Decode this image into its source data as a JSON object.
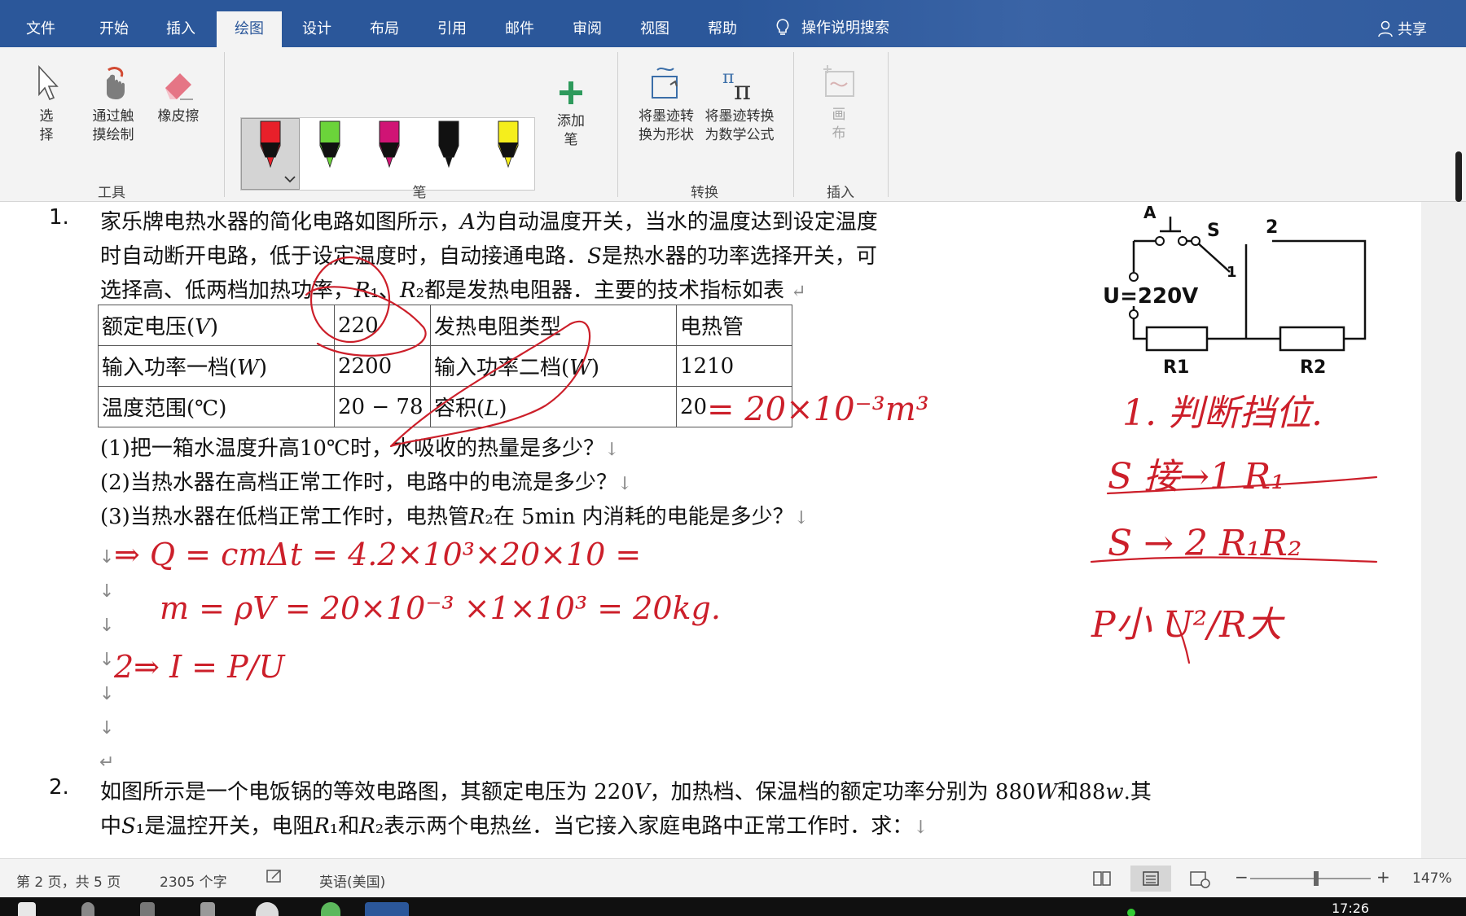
{
  "ribbon_tabs": [
    "文件",
    "开始",
    "插入",
    "绘图",
    "设计",
    "布局",
    "引用",
    "邮件",
    "审阅",
    "视图",
    "帮助"
  ],
  "active_tab": "绘图",
  "tell_me": "操作说明搜索",
  "share": "共享",
  "tools_group": {
    "label": "工具",
    "select": "选\n择",
    "touch_draw": "通过触\n摸绘制",
    "eraser": "橡皮擦"
  },
  "pens_group": {
    "label": "笔",
    "pen_colors": [
      "#e8202a",
      "#6bd43a",
      "#d01475",
      "#111111",
      "#f5ee1c"
    ],
    "add_pen": "添加\n笔"
  },
  "convert_group": {
    "label": "转换",
    "ink_to_shape": "将墨迹转\n换为形状",
    "ink_to_math": "将墨迹转换\n为数学公式"
  },
  "insert_group": {
    "label": "插入",
    "canvas": "画\n布"
  },
  "document": {
    "q1_number": "1.",
    "q1_line1": "家乐牌电热水器的简化电路如图所示，𝐴为自动温度开关，当水的温度达到设定温度",
    "q1_line2": "时自动断开电路，低于设定温度时，自动接通电路．𝑆是热水器的功率选择开关，可",
    "q1_line3": "选择高、低两档加热功率，𝑅₁、𝑅₂都是发热电阻器．主要的技术指标如表",
    "table": [
      [
        "额定电压(𝑉)",
        "220",
        "发热电阻类型",
        "电热管"
      ],
      [
        "输入功率一档(𝑊)",
        "2200",
        "输入功率二档(𝑊)",
        "1210"
      ],
      [
        "温度范围(℃)",
        "20 − 78",
        "容积(𝐿)",
        "20"
      ]
    ],
    "sub1": "(1)把一箱水温度升高10℃时，水吸收的热量是多少？",
    "sub2": "(2)当热水器在高档正常工作时，电路中的电流是多少？",
    "sub3": "(3)当热水器在低档正常工作时，电热管𝑅₂在 5min 内消耗的电能是多少？",
    "q2_number": "2.",
    "q2_line1": "如图所示是一个电饭锅的等效电路图，其额定电压为 220𝑉，加热档、保温档的额定功率分别为 880𝑊和88𝑤.其",
    "q2_line2": "中𝑆₁是温控开关，电阻𝑅₁和𝑅₂表示两个电热丝．当它接入家庭电路中正常工作时．求：",
    "circuit_labels": {
      "a": "A",
      "s": "S",
      "two": "2",
      "one": "1",
      "voltage": "U=220V",
      "r1": "R1",
      "r2": "R2"
    },
    "ink_annotations": {
      "volume_conv": "= 20×10⁻³m³",
      "q_formula": "⇒ Q = cmΔt = 4.2×10³×20×10 =",
      "m_formula": "m = ρV = 20×10⁻³ ×1×10³ = 20kg.",
      "i_formula": "2⇒ I = P/U",
      "note1": "1. 判断挡位.",
      "note2": "S 接→1 R₁",
      "note3": "S → 2 R₁R₂",
      "note4": "P小 U²/R大"
    }
  },
  "status_bar": {
    "page": "第 2 页，共 5 页",
    "words": "2305 个字",
    "language": "英语(美国)",
    "zoom": "147%"
  },
  "taskbar": {
    "time": "17:26"
  },
  "colors": {
    "ribbon_blue": "#2b579a",
    "ink_red": "#cc1f2a"
  }
}
